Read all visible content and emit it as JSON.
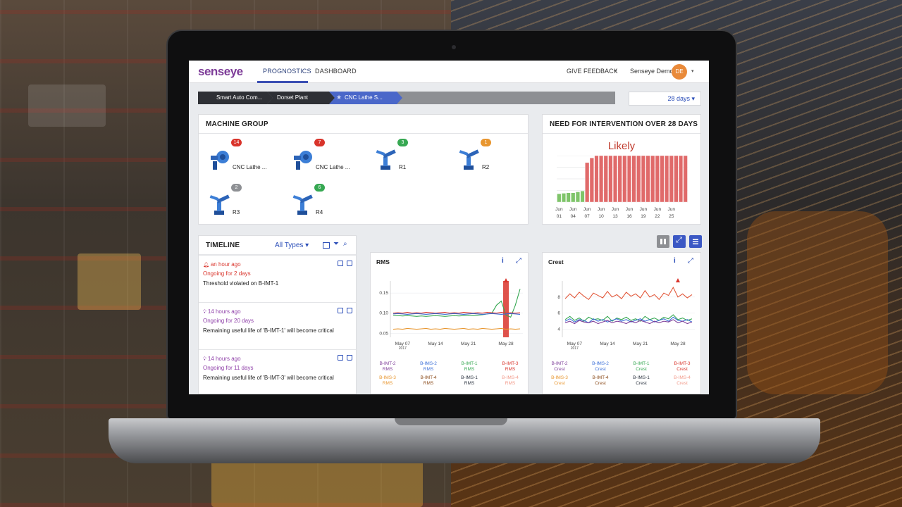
{
  "colors": {
    "brand_purple": "#7d3c98",
    "accent_blue": "#3b4fb3",
    "alert_red": "#c0392b",
    "ok_green": "#27ae60",
    "warn_orange": "#e67e22"
  },
  "header": {
    "logo_main": "sens",
    "logo_accent": "eye",
    "nav": [
      "PROGNOSTICS",
      "DASHBOARD"
    ],
    "feedback": "GIVE FEEDBACK",
    "user_name": "Senseye Demo",
    "avatar_initials": "DE"
  },
  "breadcrumb": [
    "Smart Auto Com...",
    "Dorset Plant",
    "CNC Lathe S..."
  ],
  "period": "28 days",
  "machine_group": {
    "title": "MACHINE GROUP",
    "machines": [
      {
        "label": "CNC Lathe ...",
        "badge": "14",
        "badge_color": "#d9342b",
        "icon": "lathe-icon"
      },
      {
        "label": "CNC Lathe ...",
        "badge": "7",
        "badge_color": "#d9342b",
        "icon": "lathe-icon"
      },
      {
        "label": "R1",
        "badge": "3",
        "badge_color": "#36a852",
        "icon": "robot-arm-icon"
      },
      {
        "label": "R2",
        "badge": "1",
        "badge_color": "#e8962f",
        "icon": "robot-arm-icon"
      },
      {
        "label": "R3",
        "badge": "2",
        "badge_color": "#8e9094",
        "icon": "robot-arm-icon"
      },
      {
        "label": "R4",
        "badge": "6",
        "badge_color": "#36a852",
        "icon": "robot-arm-icon"
      }
    ]
  },
  "intervention": {
    "title": "NEED FOR INTERVENTION OVER 28 DAYS",
    "status": "Likely"
  },
  "timeline": {
    "title": "TIMELINE",
    "filter": "All Types",
    "entries": [
      {
        "time": "an hour ago",
        "ongoing": "Ongoing for 2 days",
        "desc": "Threshold violated on B-IMT-1",
        "color": "#d9342b",
        "icon": "bell-icon"
      },
      {
        "time": "14 hours ago",
        "ongoing": "Ongoing for 20 days",
        "desc": "Remaining useful life of 'B-IMT-1' will become critical",
        "color": "#8e3fa8",
        "icon": "bulb-icon"
      },
      {
        "time": "14 hours ago",
        "ongoing": "Ongoing for 11 days",
        "desc": "Remaining useful life of 'B-IMT-3' will become critical",
        "color": "#8e3fa8",
        "icon": "bulb-icon"
      }
    ]
  },
  "rms_panel": {
    "title": "RMS",
    "legend": [
      {
        "name": "B-IMT-2",
        "sub": "RMS",
        "color": "#7d3c98"
      },
      {
        "name": "B-IMS-2",
        "sub": "RMS",
        "color": "#3b6fd8"
      },
      {
        "name": "B-IMT-1",
        "sub": "RMS",
        "color": "#36a852"
      },
      {
        "name": "B-IMT-3",
        "sub": "RMS",
        "color": "#d9342b"
      },
      {
        "name": "B-IMS-3",
        "sub": "RMS",
        "color": "#e8962f"
      },
      {
        "name": "B-IMT-4",
        "sub": "RMS",
        "color": "#8a4a1a"
      },
      {
        "name": "B-IMS-1",
        "sub": "RMS",
        "color": "#2c3440"
      },
      {
        "name": "B-IMS-4",
        "sub": "RMS",
        "color": "#f29a8a"
      }
    ]
  },
  "crest_panel": {
    "title": "Crest",
    "legend": [
      {
        "name": "B-IMT-2",
        "sub": "Crest",
        "color": "#7d3c98"
      },
      {
        "name": "B-IMS-2",
        "sub": "Crest",
        "color": "#3b6fd8"
      },
      {
        "name": "B-IMT-1",
        "sub": "Crest",
        "color": "#36a852"
      },
      {
        "name": "B-IMT-3",
        "sub": "Crest",
        "color": "#d9342b"
      },
      {
        "name": "B-IMS-3",
        "sub": "Crest",
        "color": "#e8962f"
      },
      {
        "name": "B-IMT-4",
        "sub": "Crest",
        "color": "#8a4a1a"
      },
      {
        "name": "B-IMS-1",
        "sub": "Crest",
        "color": "#2c3440"
      },
      {
        "name": "B-IMS-4",
        "sub": "Crest",
        "color": "#f29a8a"
      }
    ]
  },
  "chart_data": [
    {
      "type": "bar",
      "title": "",
      "categories": [
        "Jun 01",
        "Jun 02",
        "Jun 03",
        "Jun 04",
        "Jun 05",
        "Jun 06",
        "Jun 07",
        "Jun 08",
        "Jun 09",
        "Jun 10",
        "Jun 11",
        "Jun 12",
        "Jun 13",
        "Jun 14",
        "Jun 15",
        "Jun 16",
        "Jun 17",
        "Jun 18",
        "Jun 19",
        "Jun 20",
        "Jun 21",
        "Jun 22",
        "Jun 23",
        "Jun 24",
        "Jun 25",
        "Jun 26",
        "Jun 27",
        "Jun 28"
      ],
      "tick_labels": [
        [
          "Jun",
          "01"
        ],
        [
          "Jun",
          "04"
        ],
        [
          "Jun",
          "07"
        ],
        [
          "Jun",
          "10"
        ],
        [
          "Jun",
          "13"
        ],
        [
          "Jun",
          "16"
        ],
        [
          "Jun",
          "19"
        ],
        [
          "Jun",
          "22"
        ],
        [
          "Jun",
          "25"
        ]
      ],
      "tick_index": [
        0,
        3,
        6,
        9,
        12,
        15,
        18,
        21,
        24
      ],
      "values": [
        0.18,
        0.19,
        0.2,
        0.2,
        0.22,
        0.24,
        0.85,
        0.95,
        1,
        1,
        1,
        1,
        1,
        1,
        1,
        1,
        1,
        1,
        1,
        1,
        1,
        1,
        1,
        1,
        1,
        1,
        1,
        1
      ],
      "colors": [
        "#7fc46a",
        "#7fc46a",
        "#7fc46a",
        "#7fc46a",
        "#7fc46a",
        "#7fc46a",
        "#e06a6a",
        "#e06a6a",
        "#e06a6a",
        "#e06a6a",
        "#e06a6a",
        "#e06a6a",
        "#e06a6a",
        "#e06a6a",
        "#e06a6a",
        "#e06a6a",
        "#e06a6a",
        "#e06a6a",
        "#e06a6a",
        "#e06a6a",
        "#e06a6a",
        "#e06a6a",
        "#e06a6a",
        "#e06a6a",
        "#e06a6a",
        "#e06a6a",
        "#e06a6a",
        "#e06a6a"
      ],
      "ylim": [
        0,
        1
      ],
      "grid": true
    },
    {
      "type": "line",
      "title": "RMS",
      "x_ticks": [
        [
          "May 07",
          "2017"
        ],
        [
          "May 14",
          ""
        ],
        [
          "May 21",
          ""
        ],
        [
          "May 28",
          ""
        ]
      ],
      "y_ticks": [
        "0.15",
        "0.10",
        "0.05"
      ],
      "ylim": [
        0.04,
        0.18
      ],
      "series": [
        {
          "name": "B-IMT-1",
          "color": "#36a852",
          "values": [
            0.095,
            0.094,
            0.093,
            0.094,
            0.093,
            0.092,
            0.093,
            0.092,
            0.093,
            0.094,
            0.093,
            0.092,
            0.093,
            0.094,
            0.093,
            0.094,
            0.095,
            0.094,
            0.095,
            0.096,
            0.098,
            0.1,
            0.12,
            0.13,
            0.095,
            0.09,
            0.12,
            0.16
          ]
        },
        {
          "name": "B-IMT-3",
          "color": "#d9342b",
          "values": [
            0.1,
            0.101,
            0.1,
            0.102,
            0.1,
            0.101,
            0.1,
            0.102,
            0.101,
            0.1,
            0.101,
            0.102,
            0.1,
            0.101,
            0.1,
            0.102,
            0.101,
            0.1,
            0.101,
            0.1,
            0.102,
            0.101,
            0.1,
            0.102,
            0.1,
            0.101,
            0.1,
            0.101
          ]
        },
        {
          "name": "B-IMS-2",
          "color": "#3b6fd8",
          "values": [
            0.098,
            0.099,
            0.098,
            0.097,
            0.098,
            0.099,
            0.098,
            0.097,
            0.098,
            0.099,
            0.098,
            0.097,
            0.098,
            0.099,
            0.098,
            0.097,
            0.098,
            0.099,
            0.098,
            0.097,
            0.098,
            0.099,
            0.098,
            0.097,
            0.098,
            0.099,
            0.098,
            0.097
          ]
        },
        {
          "name": "B-IMS-3",
          "color": "#e8962f",
          "values": [
            0.06,
            0.061,
            0.06,
            0.062,
            0.061,
            0.06,
            0.061,
            0.062,
            0.06,
            0.061,
            0.06,
            0.062,
            0.061,
            0.06,
            0.061,
            0.062,
            0.06,
            0.061,
            0.06,
            0.062,
            0.061,
            0.06,
            0.061,
            0.062,
            0.06,
            0.061,
            0.06,
            0.061
          ]
        }
      ],
      "highlight": "May 25"
    },
    {
      "type": "line",
      "title": "Crest",
      "x_ticks": [
        [
          "May 07",
          "2017"
        ],
        [
          "May 14",
          ""
        ],
        [
          "May 21",
          ""
        ],
        [
          "May 28",
          ""
        ]
      ],
      "y_ticks": [
        "8",
        "6",
        "4"
      ],
      "ylim": [
        3,
        10
      ],
      "series": [
        {
          "name": "B-IMT-3",
          "color": "#e2583a",
          "values": [
            7.8,
            8.4,
            7.9,
            8.6,
            8.1,
            7.7,
            8.5,
            8.2,
            7.9,
            8.7,
            8.0,
            8.3,
            7.8,
            8.6,
            8.1,
            8.4,
            7.9,
            8.8,
            8.0,
            8.3,
            7.7,
            8.5,
            8.2,
            9.2,
            8.0,
            8.4,
            7.9,
            8.3
          ]
        },
        {
          "name": "B-IMT-1",
          "color": "#36a852",
          "values": [
            5.2,
            5.6,
            5.1,
            5.4,
            5.0,
            5.5,
            5.2,
            5.3,
            5.1,
            5.6,
            5.0,
            5.4,
            5.2,
            5.5,
            5.1,
            5.3,
            5.0,
            5.6,
            5.2,
            5.4,
            5.1,
            5.5,
            5.3,
            5.8,
            5.2,
            5.4,
            5.1,
            5.3
          ]
        },
        {
          "name": "B-IMS-2",
          "color": "#3b6fd8",
          "values": [
            5.0,
            5.3,
            4.9,
            5.2,
            5.1,
            4.8,
            5.3,
            5.0,
            5.2,
            4.9,
            5.1,
            5.3,
            5.0,
            5.2,
            4.9,
            5.1,
            5.3,
            5.0,
            5.2,
            4.9,
            5.1,
            5.3,
            5.0,
            5.5,
            5.1,
            5.0,
            5.2,
            4.9
          ]
        },
        {
          "name": "B-IMT-2",
          "color": "#7d3c98",
          "values": [
            4.8,
            5.0,
            4.7,
            5.1,
            4.9,
            4.8,
            5.0,
            4.7,
            4.9,
            5.1,
            4.8,
            5.0,
            4.9,
            4.7,
            5.0,
            4.8,
            5.1,
            4.9,
            4.7,
            5.0,
            4.8,
            5.0,
            4.9,
            5.2,
            4.8,
            5.0,
            4.7,
            4.9
          ]
        }
      ],
      "highlight": "May 25"
    }
  ]
}
